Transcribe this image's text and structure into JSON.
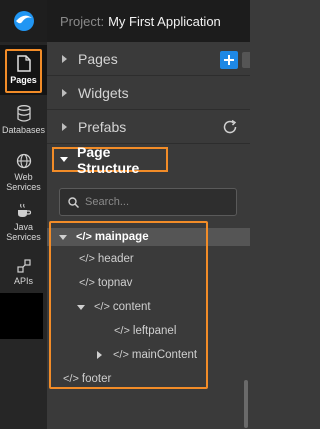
{
  "header": {
    "prefix": "Project:",
    "project_name": "My First Application"
  },
  "rail": {
    "pages": "Pages",
    "databases": "Databases",
    "web_services_1": "Web",
    "web_services_2": "Services",
    "java_services_1": "Java",
    "java_services_2": "Services",
    "apis": "APIs"
  },
  "sections": {
    "pages": "Pages",
    "widgets": "Widgets",
    "prefabs": "Prefabs",
    "page_structure": "Page Structure"
  },
  "search": {
    "placeholder": "Search..."
  },
  "tree": {
    "root": "mainpage",
    "header": "header",
    "topnav": "topnav",
    "content": "content",
    "leftpanel": "leftpanel",
    "mainContent": "mainContent",
    "footer": "footer",
    "code_glyph": "</>"
  },
  "colors": {
    "accent": "#f28c28",
    "brand_blue": "#1e88e5"
  }
}
